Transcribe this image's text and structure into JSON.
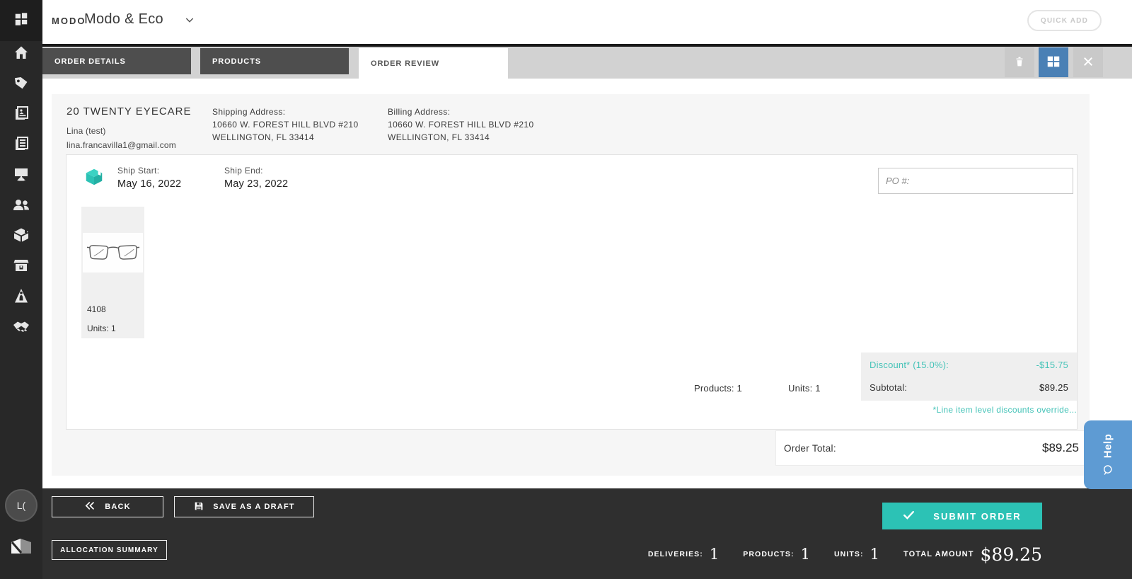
{
  "header": {
    "brand_logo": "MODO",
    "account_name": "Modo & Eco",
    "quick_add_label": "QUICK ADD"
  },
  "tabs": [
    {
      "label": "ORDER DETAILS",
      "active": false
    },
    {
      "label": "PRODUCTS",
      "active": false
    },
    {
      "label": "ORDER REVIEW",
      "active": true
    }
  ],
  "tabbar_icons": [
    "delete-icon",
    "grid-view-icon",
    "close-icon"
  ],
  "sidebar": {
    "icons": [
      "app-launcher-icon",
      "home-icon",
      "tag-icon",
      "catalog-icon",
      "linesheet-icon",
      "showroom-icon",
      "customers-icon",
      "shipments-icon",
      "storefront-icon",
      "fit-icon",
      "partners-icon"
    ],
    "avatar_initials": "L("
  },
  "customer": {
    "name": "20 TWENTY EYECARE",
    "contact": "Lina (test)",
    "email": "lina.francavilla1@gmail.com",
    "shipping_label": "Shipping Address:",
    "shipping_line1": "10660 W. FOREST HILL BLVD #210",
    "shipping_line2": "WELLINGTON, FL 33414",
    "billing_label": "Billing Address:",
    "billing_line1": "10660 W. FOREST HILL BLVD #210",
    "billing_line2": "WELLINGTON, FL 33414"
  },
  "delivery": {
    "ship_start_label": "Ship Start:",
    "ship_start_value": "May 16, 2022",
    "ship_end_label": "Ship End:",
    "ship_end_value": "May 23, 2022",
    "po_placeholder": "PO #:"
  },
  "product": {
    "sku": "4108",
    "units": "Units: 1"
  },
  "totals": {
    "products_summary": "Products: 1",
    "units_summary": "Units: 1",
    "discount_label": "Discount* (15.0%):",
    "discount_value": "-$15.75",
    "subtotal_label": "Subtotal:",
    "subtotal_value": "$89.25",
    "discount_note": "*Line item level discounts override...",
    "order_total_label": "Order Total:",
    "order_total_value": "$89.25"
  },
  "help": {
    "label": "Help"
  },
  "footer": {
    "back_label": "BACK",
    "save_draft_label": "SAVE AS A DRAFT",
    "submit_label": "SUBMIT ORDER",
    "allocation_label": "ALLOCATION SUMMARY",
    "deliveries_label": "DELIVERIES:",
    "deliveries_value": "1",
    "products_label": "PRODUCTS:",
    "products_value": "1",
    "units_label": "UNITS:",
    "units_value": "1",
    "total_label": "TOTAL AMOUNT",
    "total_value": "$89.25"
  },
  "colors": {
    "accent_teal": "#2cc2b5",
    "discount_teal": "#45c3b8",
    "grid_button_blue": "#4a80b5",
    "help_blue": "#5e9bd3",
    "dark_bar": "#2f2f2f",
    "sidebar_dark": "#282828",
    "tab_inactive": "#4e4e4e",
    "tabbar_bg": "#d2d2d2"
  }
}
